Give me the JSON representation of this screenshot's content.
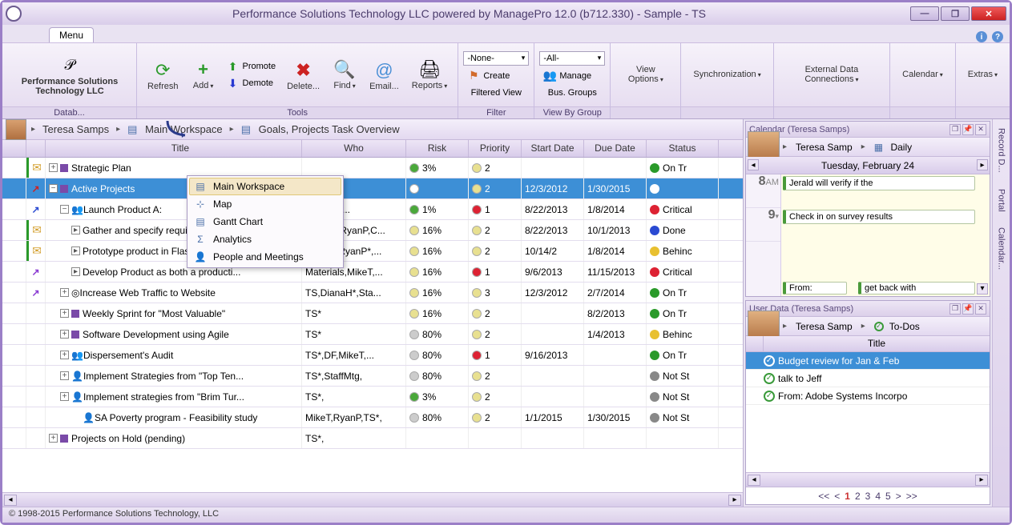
{
  "app": {
    "title": "Performance Solutions Technology LLC powered by ManagePro 12.0 (b712.330) - Sample - TS",
    "company_logo_text": "Performance Solutions Technology LLC",
    "footer": "© 1998-2015 Performance Solutions Technology, LLC"
  },
  "menu_tab": "Menu",
  "ribbon": {
    "groups": {
      "databases": {
        "label": "Datab..."
      },
      "tools": {
        "label": "Tools",
        "refresh": "Refresh",
        "add": "Add",
        "promote": "Promote",
        "demote": "Demote",
        "delete": "Delete...",
        "find": "Find",
        "email": "Email...",
        "reports": "Reports"
      },
      "filter": {
        "label": "Filter",
        "none": "-None-",
        "create": "Create",
        "filtered_view": "Filtered View"
      },
      "view_by_group": {
        "label": "View By Group",
        "all": "-All-",
        "manage": "Manage",
        "bus_groups": "Bus. Groups"
      },
      "view_options": "View Options",
      "synchronization": "Synchronization",
      "external_data": "External Data Connections",
      "calendar": "Calendar",
      "extras": "Extras"
    }
  },
  "breadcrumb": {
    "user": "Teresa Samps",
    "workspace": "Main Workspace",
    "view": "Goals, Projects  Task Overview"
  },
  "context_menu": {
    "items": [
      "Main Workspace",
      "Map",
      "Gantt Chart",
      "Analytics",
      "People and Meetings"
    ]
  },
  "grid": {
    "headers": {
      "title": "Title",
      "who": "Who",
      "risk": "Risk",
      "priority": "Priority",
      "start": "Start Date",
      "due": "Due Date",
      "status": "Status"
    },
    "rows": [
      {
        "flag": "mail-green",
        "indent": 0,
        "toggle": "+",
        "icon": "#7a4aa8",
        "title": "Strategic Plan",
        "who": "",
        "risk_c": "#4aa83a",
        "risk": "3%",
        "prio_c": "#e8e090",
        "prio": "2",
        "start": "",
        "due": "",
        "status_c": "#2a9a2a",
        "status": "On Tr"
      },
      {
        "flag": "arrow-red",
        "indent": 0,
        "toggle": "-",
        "icon": "#7a4aa8",
        "title": "Active Projects",
        "who": "",
        "risk_c": "#ffffff",
        "risk": "",
        "prio_c": "#e8e090",
        "prio": "2",
        "start": "12/3/2012",
        "due": "1/30/2015",
        "status_c": "#ffffff",
        "status": "",
        "sel": true
      },
      {
        "flag": "arrow-blue",
        "indent": 1,
        "toggle": "-",
        "icon": "people",
        "title": "Launch Product A:",
        "who": "MariaS*,...",
        "risk_c": "#4aa83a",
        "risk": "1%",
        "prio_c": "#d23",
        "prio": "1",
        "start": "8/22/2013",
        "due": "1/8/2014",
        "status_c": "#d23",
        "status": "Critical"
      },
      {
        "flag": "mail-green",
        "indent": 2,
        "toggle": "▸",
        "icon": "",
        "title": "Gather and specify requirements",
        "who": "DianaH,RyanP,C...",
        "risk_c": "#e8e090",
        "risk": "16%",
        "prio_c": "#e8e090",
        "prio": "2",
        "start": "8/22/2013",
        "due": "10/1/2013",
        "status_c": "#2a4ad2",
        "status": "Done"
      },
      {
        "flag": "mail-green",
        "indent": 2,
        "toggle": "▸",
        "icon": "",
        "title": "Prototype product in Flash and rec...",
        "who": "MariaS,RyanP*,...",
        "risk_c": "#e8e090",
        "risk": "16%",
        "prio_c": "#e8e090",
        "prio": "2",
        "start": "10/14/2",
        "due": "1/8/2014",
        "status_c": "#e8c030",
        "status": "Behinc"
      },
      {
        "flag": "arrow-purple",
        "indent": 2,
        "toggle": "▸",
        "icon": "",
        "title": "Develop Product as both a producti...",
        "who": "Materials,MikeT,...",
        "risk_c": "#e8e090",
        "risk": "16%",
        "prio_c": "#d23",
        "prio": "1",
        "start": "9/6/2013",
        "due": "11/15/2013",
        "status_c": "#d23",
        "status": "Critical"
      },
      {
        "flag": "arrow-purple",
        "indent": 1,
        "toggle": "+",
        "icon": "target",
        "title": "Increase Web Traffic to Website",
        "who": "TS,DianaH*,Sta...",
        "risk_c": "#e8e090",
        "risk": "16%",
        "prio_c": "#e8e090",
        "prio": "3",
        "start": "12/3/2012",
        "due": "2/7/2014",
        "status_c": "#2a9a2a",
        "status": "On Tr"
      },
      {
        "flag": "",
        "indent": 1,
        "toggle": "+",
        "icon": "#7a4aa8",
        "title": "Weekly Sprint for \"Most Valuable\"",
        "who": "TS*",
        "risk_c": "#e8e090",
        "risk": "16%",
        "prio_c": "#e8e090",
        "prio": "2",
        "start": "",
        "due": "8/2/2013",
        "status_c": "#2a9a2a",
        "status": "On Tr"
      },
      {
        "flag": "",
        "indent": 1,
        "toggle": "+",
        "icon": "#7a4aa8",
        "title": "Software Development using Agile",
        "who": "TS*",
        "risk_c": "#ccc",
        "risk": "80%",
        "prio_c": "#e8e090",
        "prio": "2",
        "start": "",
        "due": "1/4/2013",
        "status_c": "#e8c030",
        "status": "Behinc"
      },
      {
        "flag": "",
        "indent": 1,
        "toggle": "+",
        "icon": "people",
        "title": "Dispersement's Audit",
        "who": "TS*,DF,MikeT,...",
        "risk_c": "#ccc",
        "risk": "80%",
        "prio_c": "#d23",
        "prio": "1",
        "start": "9/16/2013",
        "due": "",
        "status_c": "#2a9a2a",
        "status": "On Tr"
      },
      {
        "flag": "",
        "indent": 1,
        "toggle": "+",
        "icon": "person",
        "title": "Implement Strategies from \"Top Ten...",
        "who": "TS*,StaffMtg,",
        "risk_c": "#ccc",
        "risk": "80%",
        "prio_c": "#e8e090",
        "prio": "2",
        "start": "",
        "due": "",
        "status_c": "#888",
        "status": "Not St"
      },
      {
        "flag": "",
        "indent": 1,
        "toggle": "+",
        "icon": "person",
        "title": "Implement strategies from \"Brim Tur...",
        "who": "TS*,",
        "risk_c": "#4aa83a",
        "risk": "3%",
        "prio_c": "#e8e090",
        "prio": "2",
        "start": "",
        "due": "",
        "status_c": "#888",
        "status": "Not St"
      },
      {
        "flag": "",
        "indent": 2,
        "toggle": "",
        "icon": "person",
        "title": "SA Poverty program - Feasibility study",
        "who": "MikeT,RyanP,TS*,",
        "risk_c": "#ccc",
        "risk": "80%",
        "prio_c": "#e8e090",
        "prio": "2",
        "start": "1/1/2015",
        "due": "1/30/2015",
        "status_c": "#888",
        "status": "Not St"
      },
      {
        "flag": "",
        "indent": 0,
        "toggle": "+",
        "icon": "#7a4aa8",
        "title": "Projects on Hold (pending)",
        "who": "TS*,",
        "risk_c": "",
        "risk": "",
        "prio_c": "",
        "prio": "",
        "start": "",
        "due": "",
        "status_c": "",
        "status": ""
      }
    ]
  },
  "side_tabs": [
    "Record D...",
    "Portal",
    "Calendar..."
  ],
  "calendar_panel": {
    "title": "Calendar (Teresa Samps)",
    "bc_user": "Teresa Samp",
    "bc_view": "Daily",
    "date": "Tuesday, February 24",
    "hour1": "8",
    "hour1_ampm": "AM",
    "hour2": "9",
    "ev1": "Jerald will verify if the",
    "ev2": "Check in on survey results",
    "stub1": "From:",
    "stub2": "get back with"
  },
  "userdata_panel": {
    "title": "User Data (Teresa Samps)",
    "bc_user": "Teresa Samp",
    "bc_view": "To-Dos",
    "col_title": "Title",
    "rows": [
      {
        "label": "Budget review for Jan & Feb",
        "sel": true
      },
      {
        "label": "talk to Jeff",
        "sel": false
      },
      {
        "label": "From: Adobe Systems Incorpo",
        "sel": false
      }
    ],
    "pager": {
      "prev2": "<<",
      "prev": "<",
      "p1": "1",
      "p2": "2",
      "p3": "3",
      "p4": "4",
      "p5": "5",
      "next": ">",
      "next2": ">>"
    }
  }
}
